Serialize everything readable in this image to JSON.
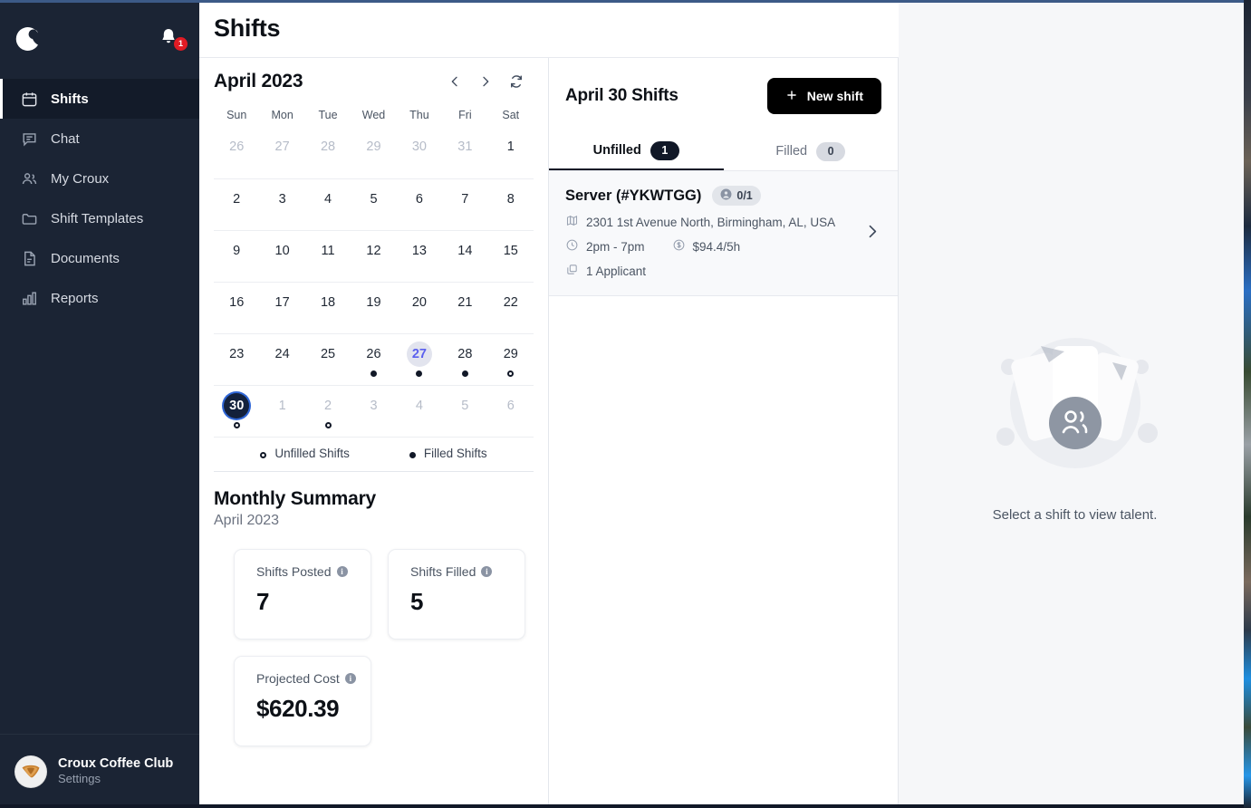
{
  "brand": {
    "logo_name": "croux-logo",
    "accent": "#5b60ee",
    "badge_color": "#e01b24"
  },
  "sidebar": {
    "notification_count": "1",
    "items": [
      {
        "label": "Shifts",
        "icon": "calendar-icon",
        "active": true
      },
      {
        "label": "Chat",
        "icon": "chat-bubble-icon",
        "active": false
      },
      {
        "label": "My Croux",
        "icon": "users-icon",
        "active": false
      },
      {
        "label": "Shift Templates",
        "icon": "folder-icon",
        "active": false
      },
      {
        "label": "Documents",
        "icon": "document-icon",
        "active": false
      },
      {
        "label": "Reports",
        "icon": "bar-chart-icon",
        "active": false
      }
    ],
    "user": {
      "name": "Croux Coffee Club",
      "settings_label": "Settings",
      "avatar": "croissant-avatar"
    }
  },
  "header": {
    "title": "Shifts"
  },
  "calendar": {
    "month_label": "April 2023",
    "prev_label": "‹",
    "next_label": "›",
    "refresh_icon": "refresh-icon",
    "day_names": [
      "Sun",
      "Mon",
      "Tue",
      "Wed",
      "Thu",
      "Fri",
      "Sat"
    ],
    "weeks": [
      [
        {
          "n": "26",
          "muted": true,
          "dot": "none"
        },
        {
          "n": "27",
          "muted": true,
          "dot": "none"
        },
        {
          "n": "28",
          "muted": true,
          "dot": "none"
        },
        {
          "n": "29",
          "muted": true,
          "dot": "none"
        },
        {
          "n": "30",
          "muted": true,
          "dot": "none"
        },
        {
          "n": "31",
          "muted": true,
          "dot": "none"
        },
        {
          "n": "1",
          "muted": false,
          "dot": "none"
        }
      ],
      [
        {
          "n": "2",
          "muted": false,
          "dot": "none"
        },
        {
          "n": "3",
          "muted": false,
          "dot": "none"
        },
        {
          "n": "4",
          "muted": false,
          "dot": "none"
        },
        {
          "n": "5",
          "muted": false,
          "dot": "none"
        },
        {
          "n": "6",
          "muted": false,
          "dot": "none"
        },
        {
          "n": "7",
          "muted": false,
          "dot": "none"
        },
        {
          "n": "8",
          "muted": false,
          "dot": "none"
        }
      ],
      [
        {
          "n": "9",
          "muted": false,
          "dot": "none"
        },
        {
          "n": "10",
          "muted": false,
          "dot": "none"
        },
        {
          "n": "11",
          "muted": false,
          "dot": "none"
        },
        {
          "n": "12",
          "muted": false,
          "dot": "none"
        },
        {
          "n": "13",
          "muted": false,
          "dot": "none"
        },
        {
          "n": "14",
          "muted": false,
          "dot": "none"
        },
        {
          "n": "15",
          "muted": false,
          "dot": "none"
        }
      ],
      [
        {
          "n": "16",
          "muted": false,
          "dot": "none"
        },
        {
          "n": "17",
          "muted": false,
          "dot": "none"
        },
        {
          "n": "18",
          "muted": false,
          "dot": "none"
        },
        {
          "n": "19",
          "muted": false,
          "dot": "none"
        },
        {
          "n": "20",
          "muted": false,
          "dot": "none"
        },
        {
          "n": "21",
          "muted": false,
          "dot": "none"
        },
        {
          "n": "22",
          "muted": false,
          "dot": "none"
        }
      ],
      [
        {
          "n": "23",
          "muted": false,
          "dot": "none"
        },
        {
          "n": "24",
          "muted": false,
          "dot": "none"
        },
        {
          "n": "25",
          "muted": false,
          "dot": "none"
        },
        {
          "n": "26",
          "muted": false,
          "dot": "filled"
        },
        {
          "n": "27",
          "muted": false,
          "dot": "filled",
          "today": true
        },
        {
          "n": "28",
          "muted": false,
          "dot": "filled"
        },
        {
          "n": "29",
          "muted": false,
          "dot": "unfilled"
        }
      ],
      [
        {
          "n": "30",
          "muted": false,
          "dot": "unfilled",
          "selected": true
        },
        {
          "n": "1",
          "muted": true,
          "dot": "none"
        },
        {
          "n": "2",
          "muted": true,
          "dot": "unfilled"
        },
        {
          "n": "3",
          "muted": true,
          "dot": "none"
        },
        {
          "n": "4",
          "muted": true,
          "dot": "none"
        },
        {
          "n": "5",
          "muted": true,
          "dot": "none"
        },
        {
          "n": "6",
          "muted": true,
          "dot": "none"
        }
      ]
    ],
    "legend": [
      {
        "label": "Unfilled Shifts",
        "style": "unfilled"
      },
      {
        "label": "Filled Shifts",
        "style": "filled"
      }
    ]
  },
  "summary": {
    "title": "Monthly Summary",
    "subtitle": "April 2023",
    "cards": [
      {
        "label": "Shifts Posted",
        "value": "7",
        "info": "i"
      },
      {
        "label": "Shifts Filled",
        "value": "5",
        "info": "i"
      },
      {
        "label": "Projected Cost",
        "value": "$620.39",
        "info": "i"
      }
    ]
  },
  "shifts_panel": {
    "title": "April 30 Shifts",
    "new_shift_label": "New shift",
    "new_shift_icon": "plus-icon",
    "tabs": [
      {
        "label": "Unfilled",
        "count": "1",
        "active": true
      },
      {
        "label": "Filled",
        "count": "0",
        "active": false
      }
    ],
    "shifts": [
      {
        "title": "Server (#YKWTGG)",
        "fill_badge": "0/1",
        "fill_badge_icon": "person-icon",
        "address": "2301 1st Avenue North, Birmingham, AL, USA",
        "address_icon": "map-icon",
        "time": "2pm - 7pm",
        "time_icon": "clock-icon",
        "rate": "$94.4/5h",
        "rate_icon": "dollar-circle-icon",
        "applicants": "1 Applicant",
        "applicants_icon": "copy-icon",
        "chevron_icon": "chevron-right-icon"
      }
    ]
  },
  "talent_panel": {
    "empty_text": "Select a shift to view talent.",
    "illustration": "people-empty-illustration"
  }
}
